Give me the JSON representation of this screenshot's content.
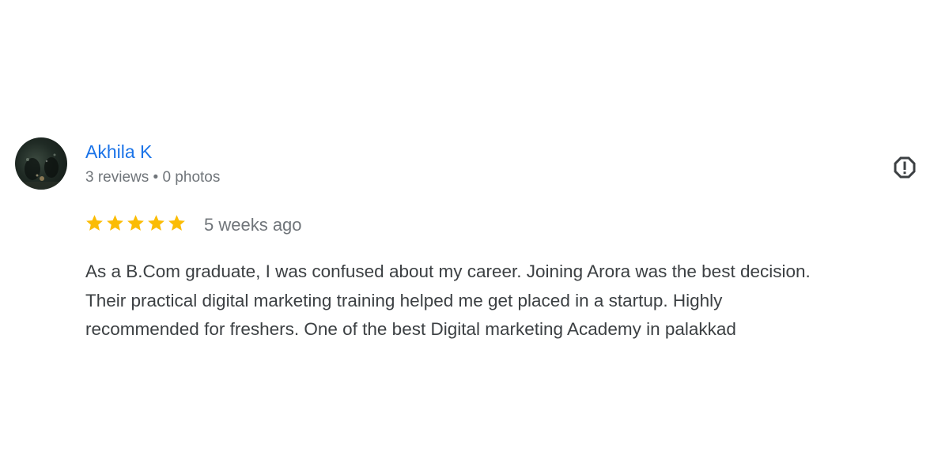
{
  "review": {
    "reviewer_name": "Akhila K",
    "reviewer_meta": "3 reviews • 0 photos",
    "rating": 5,
    "rating_max": 5,
    "time_ago": "5 weeks ago",
    "text_lines": [
      "As a B.Com graduate, I was confused about my career. Joining Arora was the best decision.",
      "Their practical digital marketing training helped me get placed in a startup. Highly",
      "recommended for freshers. One of the best Digital marketing Academy in palakkad"
    ]
  },
  "icons": {
    "report": "report-flag-icon",
    "star": "star-icon"
  },
  "colors": {
    "name_link": "#1a73e8",
    "star_fill": "#fbbc04",
    "meta_text": "#70757a",
    "body_text": "#3c4043",
    "report_icon": "#3c4043"
  }
}
